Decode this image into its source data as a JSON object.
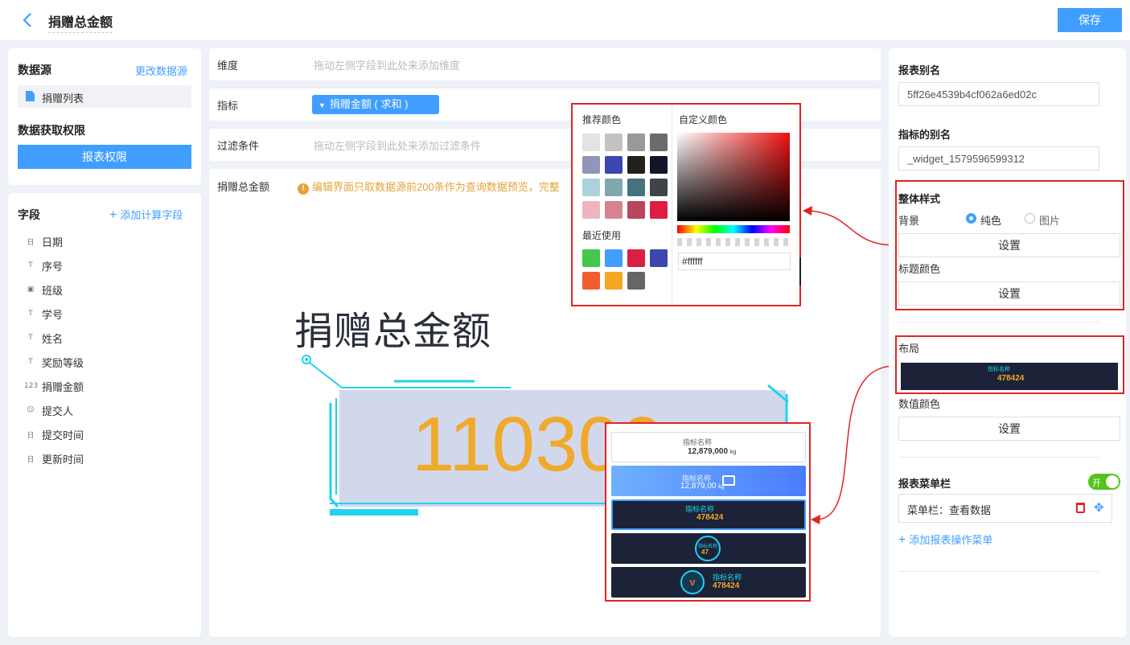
{
  "header": {
    "title": "捐赠总金额",
    "save_label": "保存"
  },
  "datasource": {
    "title": "数据源",
    "change_label": "更改数据源",
    "item": "捐赠列表",
    "perm_title": "数据获取权限",
    "perm_button": "报表权限"
  },
  "fields": {
    "title": "字段",
    "add_label": "添加计算字段",
    "items": [
      {
        "icon": "日",
        "label": "日期"
      },
      {
        "icon": "T",
        "label": "序号"
      },
      {
        "icon": "▣",
        "label": "班级"
      },
      {
        "icon": "T",
        "label": "学号"
      },
      {
        "icon": "T",
        "label": "姓名"
      },
      {
        "icon": "T",
        "label": "奖励等级"
      },
      {
        "icon": "123",
        "label": "捐赠金额"
      },
      {
        "icon": "☺",
        "label": "提交人"
      },
      {
        "icon": "日",
        "label": "提交时间"
      },
      {
        "icon": "日",
        "label": "更新时间"
      }
    ]
  },
  "editor": {
    "dimension_label": "维度",
    "dimension_placeholder": "拖动左侧字段到此处来添加维度",
    "metric_label": "指标",
    "metric_value": "捐赠金额 ( 求和 )",
    "filter_label": "过滤条件",
    "filter_placeholder": "拖动左侧字段到此处来添加过滤条件",
    "canvas_label": "捐赠总金额",
    "warning": "编辑界面只取数据源前200条作为查询数据预览，完整"
  },
  "widget": {
    "title": "捐赠总金额",
    "value": "110300"
  },
  "color_picker": {
    "recommended_label": "推荐颜色",
    "recent_label": "最近使用",
    "custom_label": "自定义颜色",
    "hex_value": "#ffffff",
    "recommended": [
      "#e3e3e3",
      "#c2c2c2",
      "#999999",
      "#6b6b6b",
      "#8f96b8",
      "#3d46b0",
      "#22221a",
      "#121428",
      "#acd2db",
      "#81a6ae",
      "#44737e",
      "#3e4447",
      "#edb5c1",
      "#d6828f",
      "#b9465c",
      "#dd1e44"
    ],
    "recent": [
      "#43c84b",
      "#409eff",
      "#dd1e44",
      "#3d46b0",
      "#f25d30",
      "#f5a623",
      "#666666"
    ]
  },
  "layout_options": [
    {
      "label": "指标名称",
      "value": "12,879,000",
      "unit": "kg"
    },
    {
      "label": "指标名称",
      "value": "12,879,00",
      "unit": "kg"
    },
    {
      "label": "指标名称",
      "value": "478424"
    },
    {
      "label": "指标名称",
      "value": "47"
    },
    {
      "label": "指标名称",
      "value": "478424"
    }
  ],
  "settings": {
    "alias_title": "报表别名",
    "alias_value": "5ff26e4539b4cf062a6ed02c",
    "metric_alias_title": "指标的别名",
    "metric_alias_value": "_widget_1579596599312",
    "style_title": "整体样式",
    "bg_label": "背景",
    "bg_solid": "纯色",
    "bg_image": "图片",
    "set_label": "设置",
    "title_color_label": "标题颜色",
    "layout_label": "布局",
    "preview_label": "指标名称",
    "preview_value": "478424",
    "value_color_label": "数值颜色",
    "menu_title": "报表菜单栏",
    "toggle_label": "开",
    "menu_item": "菜单栏：查看数据",
    "add_menu_label": "添加报表操作菜单"
  }
}
